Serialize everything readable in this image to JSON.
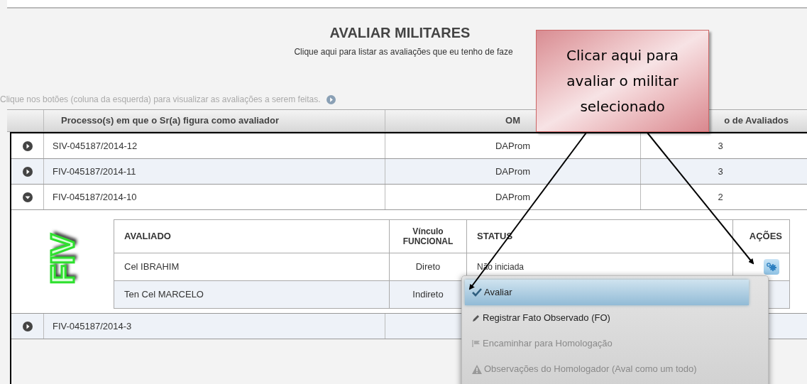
{
  "page": {
    "title": "AVALIAR MILITARES",
    "subtitle": "Clique aqui para listar as avaliações que eu tenho de faze",
    "hint": "Clique nos botões (coluna da esquerda) para visualizar as avaliações a serem feitas."
  },
  "table": {
    "columns": [
      "Processo(s) em que o Sr(a) figura como avaliador",
      "OM",
      "o de Avaliados"
    ],
    "rows": [
      {
        "processo": "SIV-045187/2014-12",
        "om": "DAProm",
        "count": "3",
        "expanded": false
      },
      {
        "processo": "FIV-045187/2014-11",
        "om": "DAProm",
        "count": "3",
        "expanded": false
      },
      {
        "processo": "FIV-045187/2014-10",
        "om": "DAProm",
        "count": "2",
        "expanded": true,
        "detail": {
          "logo": "FIV",
          "columns": [
            "AVALIADO",
            "Vínculo FUNCIONAL",
            "STATUS",
            "AÇÕES"
          ],
          "rows": [
            {
              "avaliado": "Cel IBRAHIM",
              "vinculo": "Direto",
              "status": "Não iniciada",
              "gear": true
            },
            {
              "avaliado": "Ten Cel MARCELO",
              "vinculo": "Indireto"
            }
          ]
        }
      },
      {
        "processo": "FIV-045187/2014-3",
        "expanded": false
      }
    ]
  },
  "menu": [
    {
      "label": "Avaliar",
      "kind": "check",
      "selected": true,
      "disabled": false
    },
    {
      "label": "Registrar Fato Observado (FO)",
      "kind": "pencil",
      "selected": false,
      "disabled": false
    },
    {
      "label": "Encaminhar para Homologação",
      "kind": "flag",
      "selected": false,
      "disabled": true
    },
    {
      "label": "Observações do Homologador (Aval como um todo)",
      "kind": "warning",
      "selected": false,
      "disabled": true
    }
  ],
  "callout": {
    "text": "Clicar aqui para avaliar o militar selecionado"
  }
}
